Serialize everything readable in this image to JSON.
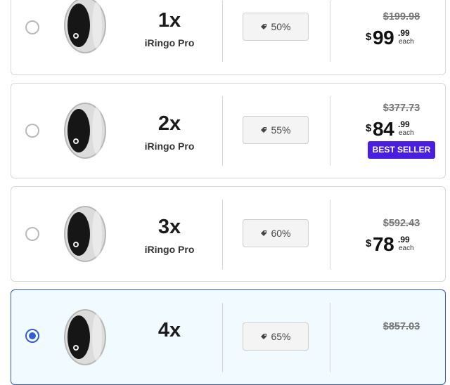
{
  "offers": [
    {
      "qty": "1x",
      "name": "iRingo Pro",
      "discount": "50%",
      "old_price": "$199.98",
      "currency": "$",
      "price_whole": "99",
      "price_cents": ".99",
      "unit": "each",
      "badge": "",
      "selected": false
    },
    {
      "qty": "2x",
      "name": "iRingo Pro",
      "discount": "55%",
      "old_price": "$377.73",
      "currency": "$",
      "price_whole": "84",
      "price_cents": ".99",
      "unit": "each",
      "badge": "BEST SELLER",
      "selected": false
    },
    {
      "qty": "3x",
      "name": "iRingo Pro",
      "discount": "60%",
      "old_price": "$592.43",
      "currency": "$",
      "price_whole": "78",
      "price_cents": ".99",
      "unit": "each",
      "badge": "",
      "selected": false
    },
    {
      "qty": "4x",
      "name": "",
      "discount": "65%",
      "old_price": "$857.03",
      "currency": "",
      "price_whole": "",
      "price_cents": "",
      "unit": "",
      "badge": "",
      "selected": true
    }
  ],
  "colors": {
    "accent": "#2f5fd0",
    "badge_bg": "#4a1ee0",
    "selected_bg": "#f1fbff"
  },
  "icons": {
    "discount": "tag-icon",
    "product": "ring-image"
  }
}
